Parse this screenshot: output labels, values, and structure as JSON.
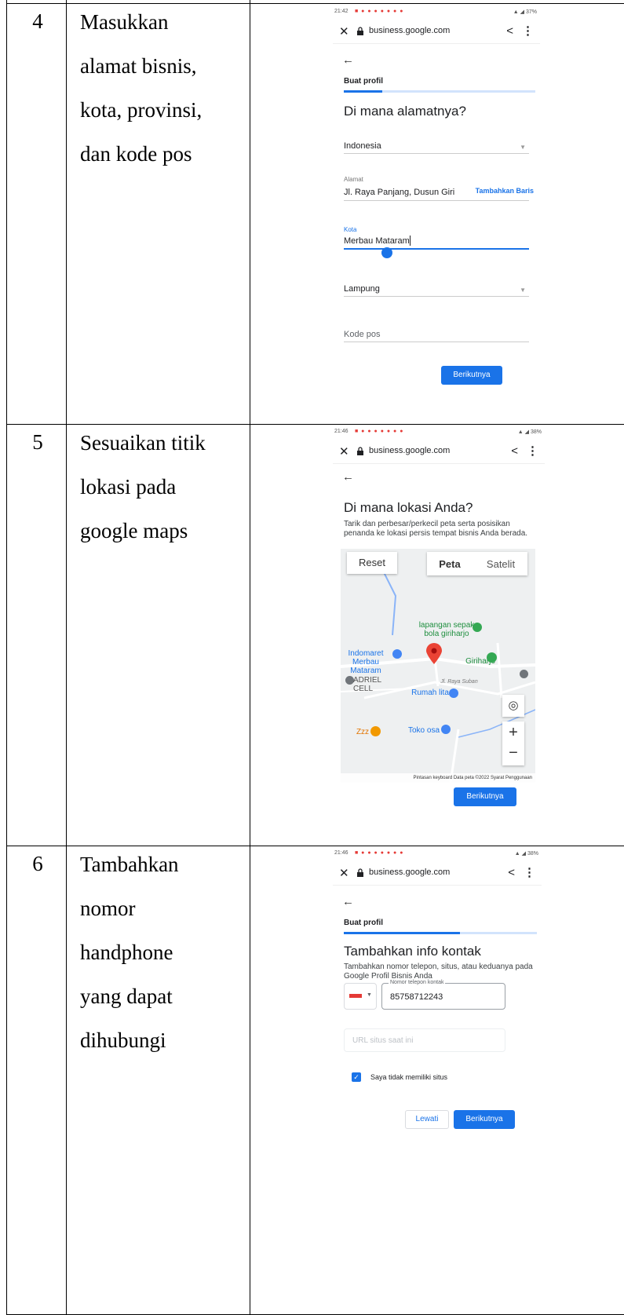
{
  "rows": [
    {
      "number": "4",
      "description_lines": [
        "Masukkan",
        "alamat bisnis,",
        "kota, provinsi,",
        "dan kode pos"
      ],
      "screen": {
        "status_time": "21:42",
        "status_right": "37%",
        "url": "business.google.com",
        "step_label": "Buat profil",
        "progress": 0.2,
        "title": "Di mana alamatnya?",
        "country": "Indonesia",
        "address_label": "Alamat",
        "address_value": "Jl. Raya Panjang, Dusun Giri",
        "add_line": "Tambahkan Baris",
        "city_label": "Kota",
        "city_value": "Merbau Mataram",
        "province": "Lampung",
        "postal_placeholder": "Kode pos",
        "next_button": "Berikutnya"
      }
    },
    {
      "number": "5",
      "description_lines": [
        "Sesuaikan titik",
        "lokasi pada",
        "google maps"
      ],
      "screen": {
        "status_time": "21:46",
        "status_right": "38%",
        "url": "business.google.com",
        "title": "Di mana lokasi Anda?",
        "subtitle": "Tarik dan perbesar/perkecil peta serta posisikan penanda ke lokasi persis tempat bisnis Anda berada.",
        "reset_button": "Reset",
        "map_type_map": "Peta",
        "map_type_satellite": "Satelit",
        "poi": {
          "lapangan": "lapangan sepak bola giriharjo",
          "indomaret": "Indomaret Merbau Mataram",
          "giriharjo": "Giriharjo",
          "adriel": "ADRIEL CELL",
          "road": "Jl. Raya Suban",
          "rumah": "Rumah lita",
          "zzz": "Zzz",
          "toko": "Toko osa"
        },
        "map_footer": "Pintasan keyboard   Data peta ©2022   Syarat Penggunaan",
        "next_button": "Berikutnya"
      }
    },
    {
      "number": "6",
      "description_lines": [
        "Tambahkan",
        "nomor",
        "handphone",
        "yang dapat",
        "dihubungi"
      ],
      "screen": {
        "status_time": "21:46",
        "status_right": "38%",
        "url": "business.google.com",
        "step_label": "Buat profil",
        "progress": 0.6,
        "title": "Tambahkan info kontak",
        "subtitle": "Tambahkan nomor telepon, situs, atau keduanya pada Google Profil Bisnis Anda",
        "phone_label": "Nomor telepon kontak",
        "phone_value": "85758712243",
        "url_placeholder": "URL situs saat ini",
        "no_site_label": "Saya tidak memiliki situs",
        "skip_button": "Lewati",
        "next_button": "Berikutnya"
      }
    }
  ],
  "colors": {
    "accent": "#1a73e8",
    "pin": "#ea4335",
    "poi_green": "#34a853"
  }
}
